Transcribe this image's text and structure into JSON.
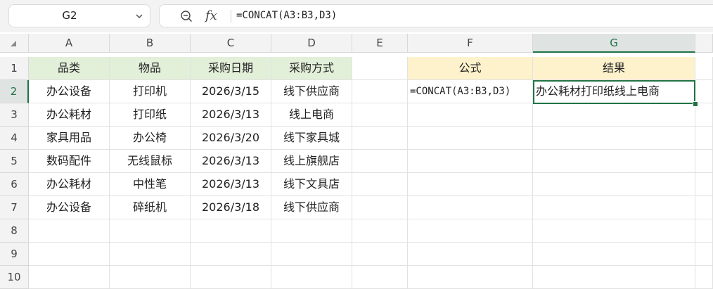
{
  "name_box": {
    "value": "G2",
    "icon": "chevron-down-icon"
  },
  "formula_bar": {
    "zoom_icon": "zoom-out-icon",
    "fx_label": "fx",
    "formula": "=CONCAT(A3:B3,D3)"
  },
  "columns": [
    "A",
    "B",
    "C",
    "D",
    "E",
    "F",
    "G"
  ],
  "selected_column": "G",
  "rows": [
    "1",
    "2",
    "3",
    "4",
    "5",
    "6",
    "7",
    "8",
    "9",
    "10"
  ],
  "selected_row": "2",
  "table": {
    "headers": [
      "品类",
      "物品",
      "采购日期",
      "采购方式"
    ],
    "rows": [
      [
        "办公设备",
        "打印机",
        "2026/3/15",
        "线下供应商"
      ],
      [
        "办公耗材",
        "打印纸",
        "2026/3/13",
        "线上电商"
      ],
      [
        "家具用品",
        "办公椅",
        "2026/3/20",
        "线下家具城"
      ],
      [
        "数码配件",
        "无线鼠标",
        "2026/3/13",
        "线上旗舰店"
      ],
      [
        "办公耗材",
        "中性笔",
        "2026/3/13",
        "线下文具店"
      ],
      [
        "办公设备",
        "碎纸机",
        "2026/3/18",
        "线下供应商"
      ]
    ]
  },
  "result": {
    "formula_header": "公式",
    "result_header": "结果",
    "formula_text": "=CONCAT(A3:B3,D3)",
    "result_text": "办公耗材打印纸线上电商"
  },
  "colors": {
    "selection": "#217346",
    "header_green": "#e2efd9",
    "header_yellow": "#fdf2cc"
  }
}
